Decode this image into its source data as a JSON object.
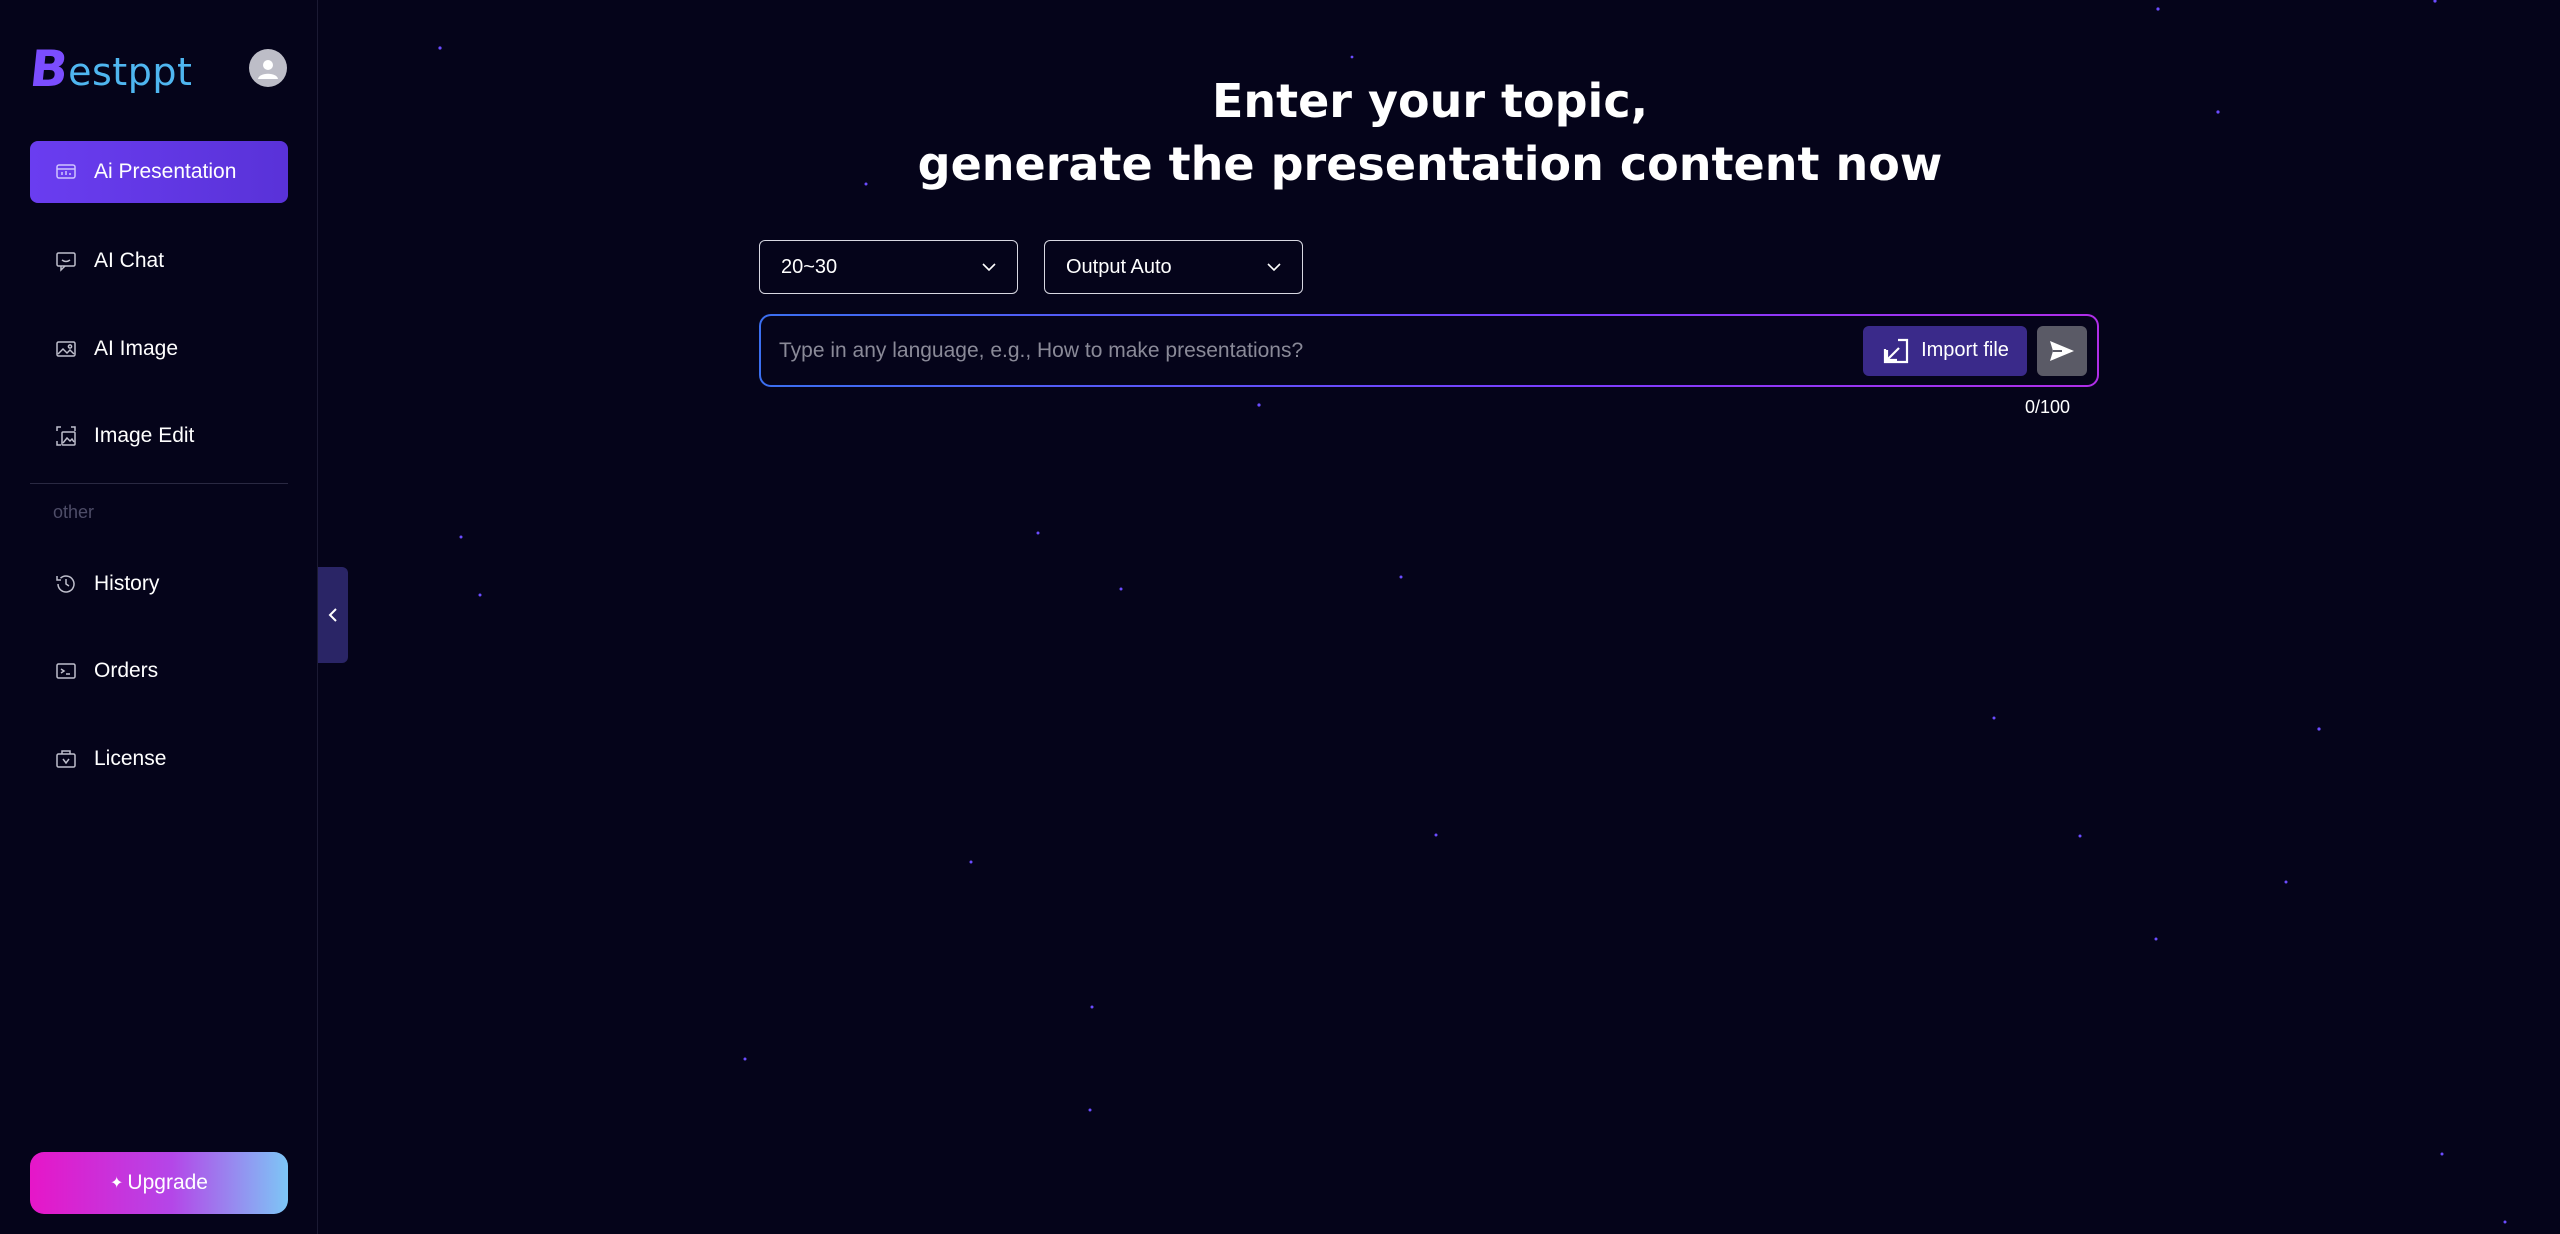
{
  "brand": {
    "logo_mark": "B",
    "logo_text": "estppt",
    "accent": "#6a3df0"
  },
  "sidebar": {
    "items": [
      {
        "label": "Ai Presentation",
        "icon": "presentation-icon",
        "active": true
      },
      {
        "label": "AI Chat",
        "icon": "chat-icon",
        "active": false
      },
      {
        "label": "AI Image",
        "icon": "image-icon",
        "active": false
      },
      {
        "label": "Image Edit",
        "icon": "image-edit-icon",
        "active": false
      }
    ],
    "section_label": "other",
    "other_items": [
      {
        "label": "History",
        "icon": "history-icon"
      },
      {
        "label": "Orders",
        "icon": "orders-icon"
      },
      {
        "label": "License",
        "icon": "license-icon"
      }
    ],
    "upgrade_label": "Upgrade"
  },
  "main": {
    "headline_line1": "Enter your topic,",
    "headline_line2": "generate the presentation content now",
    "pages_select": {
      "value": "20~30"
    },
    "output_select": {
      "value": "Output Auto"
    },
    "prompt": {
      "placeholder": "Type in any language, e.g., How to make presentations?",
      "value": ""
    },
    "import_label": "Import file",
    "counter": "0/100"
  }
}
